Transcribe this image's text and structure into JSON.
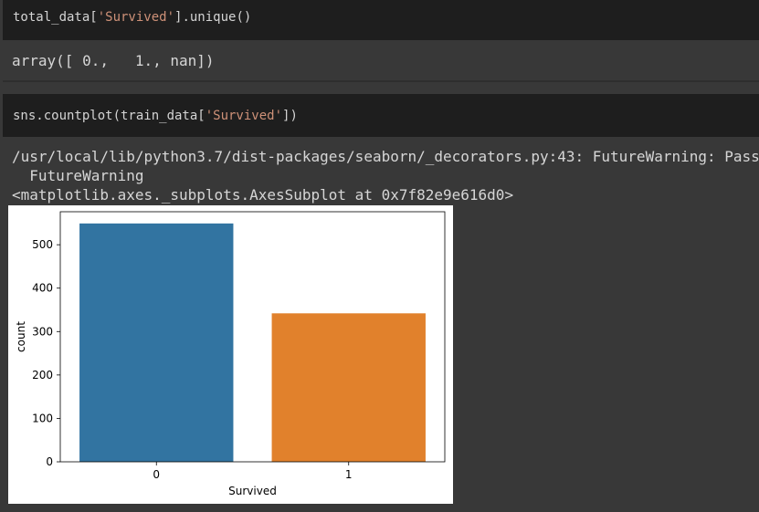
{
  "cells": [
    {
      "code_prefix": "total_data[",
      "code_string": "'Survived'",
      "code_suffix": "].unique()",
      "output": "array([ 0.,   1., nan])"
    },
    {
      "code_prefix": "sns.countplot(train_data[",
      "code_string": "'Survived'",
      "code_suffix": "])",
      "output_lines": [
        "/usr/local/lib/python3.7/dist-packages/seaborn/_decorators.py:43: FutureWarning: Pass",
        "  FutureWarning",
        "<matplotlib.axes._subplots.AxesSubplot at 0x7f82e9e616d0>"
      ]
    }
  ],
  "colors": {
    "bar_0": "#3274a1",
    "bar_1": "#e1812c",
    "code_string": "#ce9178"
  },
  "chart_data": {
    "type": "bar",
    "categories": [
      "0",
      "1"
    ],
    "values": [
      549,
      342
    ],
    "title": "",
    "xlabel": "Survived",
    "ylabel": "count",
    "ylim": [
      0,
      576
    ],
    "yticks": [
      0,
      100,
      200,
      300,
      400,
      500
    ],
    "grid": false,
    "colors": [
      "#3274a1",
      "#e1812c"
    ]
  }
}
